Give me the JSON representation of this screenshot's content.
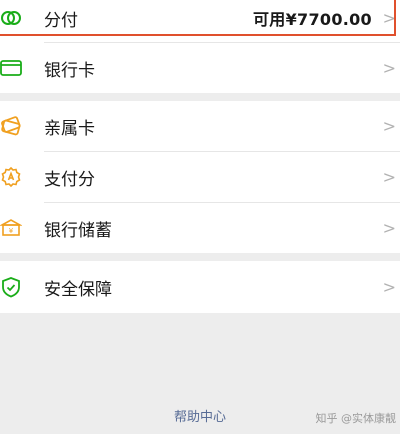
{
  "menu": {
    "fenfu": {
      "label": "分付",
      "value": "可用¥7700.00"
    },
    "bank_card": {
      "label": "银行卡"
    },
    "family_card": {
      "label": "亲属卡"
    },
    "payscore": {
      "label": "支付分"
    },
    "bank_savings": {
      "label": "银行储蓄"
    },
    "security": {
      "label": "安全保障"
    }
  },
  "chevron": ">",
  "footer": {
    "help": "帮助中心"
  },
  "watermark": "知乎 @实体康靓",
  "colors": {
    "accent_highlight": "#e0502d",
    "icon_green": "#1aad19",
    "icon_orange": "#f0a020",
    "link": "#576b95"
  }
}
